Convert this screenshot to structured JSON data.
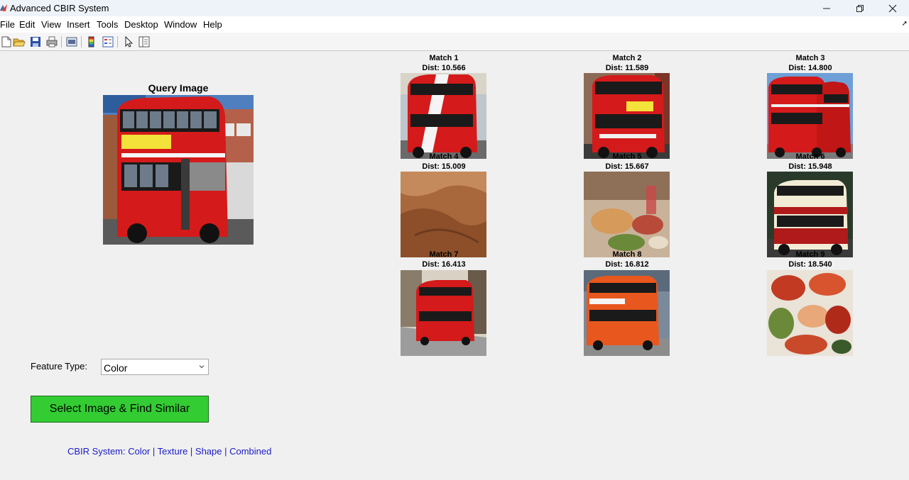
{
  "window": {
    "title": "Advanced CBIR System"
  },
  "menu": {
    "items": [
      "File",
      "Edit",
      "View",
      "Insert",
      "Tools",
      "Desktop",
      "Window",
      "Help"
    ]
  },
  "toolbar": {
    "buttons": [
      "new-figure-icon",
      "open-file-icon",
      "save-icon",
      "print-icon",
      "link-plot-icon",
      "colorbar-icon",
      "legend-icon",
      "pointer-icon",
      "property-inspector-icon"
    ]
  },
  "query": {
    "title": "Query Image"
  },
  "matches": [
    {
      "label": "Match 1",
      "dist": "Dist: 10.566"
    },
    {
      "label": "Match 2",
      "dist": "Dist: 11.589"
    },
    {
      "label": "Match 3",
      "dist": "Dist: 14.800"
    },
    {
      "label": "Match 4",
      "dist": "Dist: 15.009"
    },
    {
      "label": "Match 5",
      "dist": "Dist: 15.667"
    },
    {
      "label": "Match 6",
      "dist": "Dist: 15.948"
    },
    {
      "label": "Match 7",
      "dist": "Dist: 16.413"
    },
    {
      "label": "Match 8",
      "dist": "Dist: 16.812"
    },
    {
      "label": "Match 9",
      "dist": "Dist: 18.540"
    }
  ],
  "controls": {
    "feature_label": "Feature Type:",
    "feature_value": "Color",
    "find_button": "Select Image & Find Similar",
    "footer": "CBIR System: Color | Texture | Shape | Combined"
  },
  "colors": {
    "button_green": "#33cc33",
    "footer_blue": "#1a1ac8",
    "bus_red": "#d41a1a",
    "figure_bg": "#f0f0f0"
  }
}
